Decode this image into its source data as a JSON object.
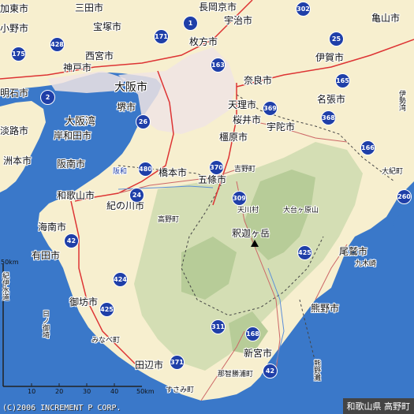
{
  "map": {
    "copyright": "(C)2006 INCREMENT P CORP.",
    "area_label": "和歌山県 高野町",
    "peak_name": "釈迦ヶ岳",
    "cities": [
      {
        "name": "加東市",
        "key": "kato"
      },
      {
        "name": "三田市",
        "key": "sanda"
      },
      {
        "name": "長岡京市",
        "key": "nagaokakyo"
      },
      {
        "name": "宇治市",
        "key": "uji"
      },
      {
        "name": "亀山市",
        "key": "kameyama"
      },
      {
        "name": "小野市",
        "key": "ono"
      },
      {
        "name": "宝塚市",
        "key": "takarazuka"
      },
      {
        "name": "枚方市",
        "key": "hirakata"
      },
      {
        "name": "西宮市",
        "key": "nishinomiya"
      },
      {
        "name": "伊賀市",
        "key": "iga"
      },
      {
        "name": "神戸市",
        "key": "kobe"
      },
      {
        "name": "奈良市",
        "key": "nara"
      },
      {
        "name": "大阪市",
        "key": "osaka"
      },
      {
        "name": "明石市",
        "key": "akashi"
      },
      {
        "name": "名張市",
        "key": "nabari"
      },
      {
        "name": "堺市",
        "key": "sakai"
      },
      {
        "name": "天理市",
        "key": "tenri"
      },
      {
        "name": "大阪湾",
        "key": "osakawan"
      },
      {
        "name": "桜井市",
        "key": "sakurai"
      },
      {
        "name": "宇陀市",
        "key": "uda"
      },
      {
        "name": "洲本市",
        "key": "sumoto"
      },
      {
        "name": "岸和田市",
        "key": "kishiwada"
      },
      {
        "name": "橿原市",
        "key": "kashihara"
      },
      {
        "name": "淡路市",
        "key": "awaji"
      },
      {
        "name": "阪南市",
        "key": "hannan"
      },
      {
        "name": "吉野町",
        "key": "yoshino"
      },
      {
        "name": "橋本市",
        "key": "hashimoto"
      },
      {
        "name": "五條市",
        "key": "gojo"
      },
      {
        "name": "大紀町",
        "key": "taiki"
      },
      {
        "name": "和歌山市",
        "key": "wakayama"
      },
      {
        "name": "天川村",
        "key": "tenkawa"
      },
      {
        "name": "大台ヶ原山",
        "key": "odaigahara"
      },
      {
        "name": "紀の川市",
        "key": "kinokawa"
      },
      {
        "name": "高野町",
        "key": "koya"
      },
      {
        "name": "海南市",
        "key": "kainan"
      },
      {
        "name": "尾鷲市",
        "key": "owase"
      },
      {
        "name": "九木崎",
        "key": "kuki"
      },
      {
        "name": "有田市",
        "key": "arida"
      },
      {
        "name": "御坊市",
        "key": "gobo"
      },
      {
        "name": "熊野市",
        "key": "kumano"
      },
      {
        "name": "日ノ御埼",
        "key": "hinomisaki"
      },
      {
        "name": "みなべ町",
        "key": "minabe"
      },
      {
        "name": "新宮市",
        "key": "shingu"
      },
      {
        "name": "田辺市",
        "key": "tanabe"
      },
      {
        "name": "那智勝浦町",
        "key": "nachikatsuura"
      },
      {
        "name": "すさみ町",
        "key": "susami"
      },
      {
        "name": "熊野灘",
        "key": "kumanonada"
      },
      {
        "name": "紀伊水道",
        "key": "kiisuido"
      },
      {
        "name": "伊勢湾",
        "key": "isewan"
      },
      {
        "name": "阪和",
        "key": "hanwa"
      }
    ],
    "routes": [
      "302",
      "1",
      "171",
      "25",
      "175",
      "428",
      "2",
      "163",
      "165",
      "369",
      "26",
      "368",
      "166",
      "480",
      "370",
      "24",
      "309",
      "260",
      "42",
      "425",
      "424",
      "311",
      "168",
      "371"
    ],
    "scale": {
      "unit": "50km",
      "ticks": [
        "10",
        "20",
        "30",
        "40"
      ],
      "end_label": "50km"
    }
  }
}
